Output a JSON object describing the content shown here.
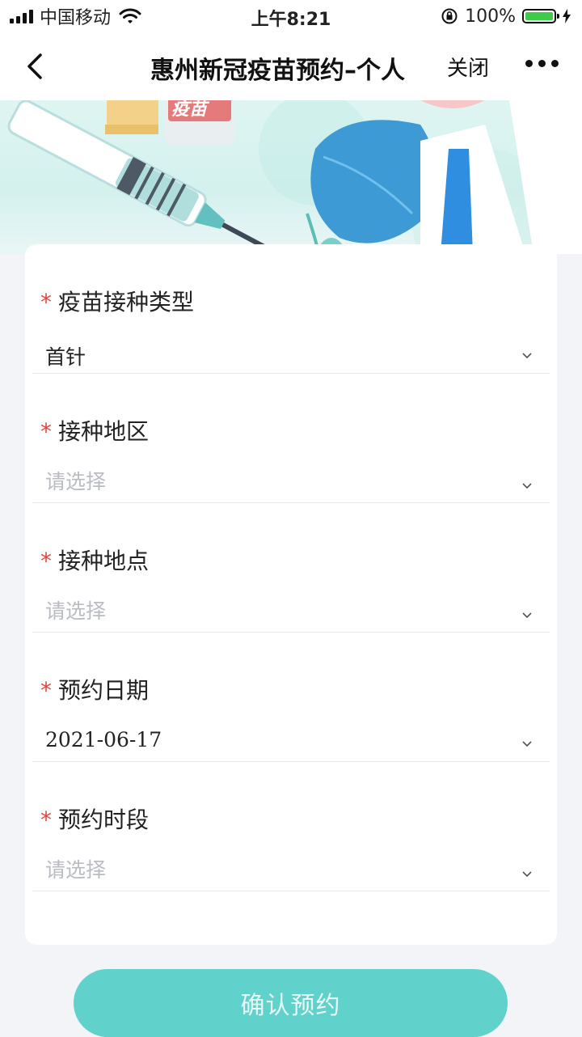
{
  "status_bar": {
    "carrier": "中国移动",
    "time": "上午8:21",
    "battery_percent": "100%",
    "battery_level": 1.0,
    "battery_color": "#3fca4b"
  },
  "nav": {
    "title": "惠州新冠疫苗预约–个人",
    "close_label": "关闭"
  },
  "banner": {
    "vial_label": "疫苗"
  },
  "form": {
    "required_mark": "*",
    "fields": [
      {
        "label": "疫苗接种类型",
        "value": "首针",
        "is_placeholder": false
      },
      {
        "label": "接种地区",
        "value": "请选择",
        "is_placeholder": true
      },
      {
        "label": "接种地点",
        "value": "请选择",
        "is_placeholder": true
      },
      {
        "label": "预约日期",
        "value": "2021-06-17",
        "is_placeholder": false
      },
      {
        "label": "预约时段",
        "value": "请选择",
        "is_placeholder": true
      }
    ]
  },
  "confirm_button": {
    "label": "确认预约",
    "color": "#61d2cb"
  },
  "colors": {
    "required": "#e0463c",
    "placeholder": "#b9bcc2",
    "page_bg": "#f2f4f7"
  }
}
